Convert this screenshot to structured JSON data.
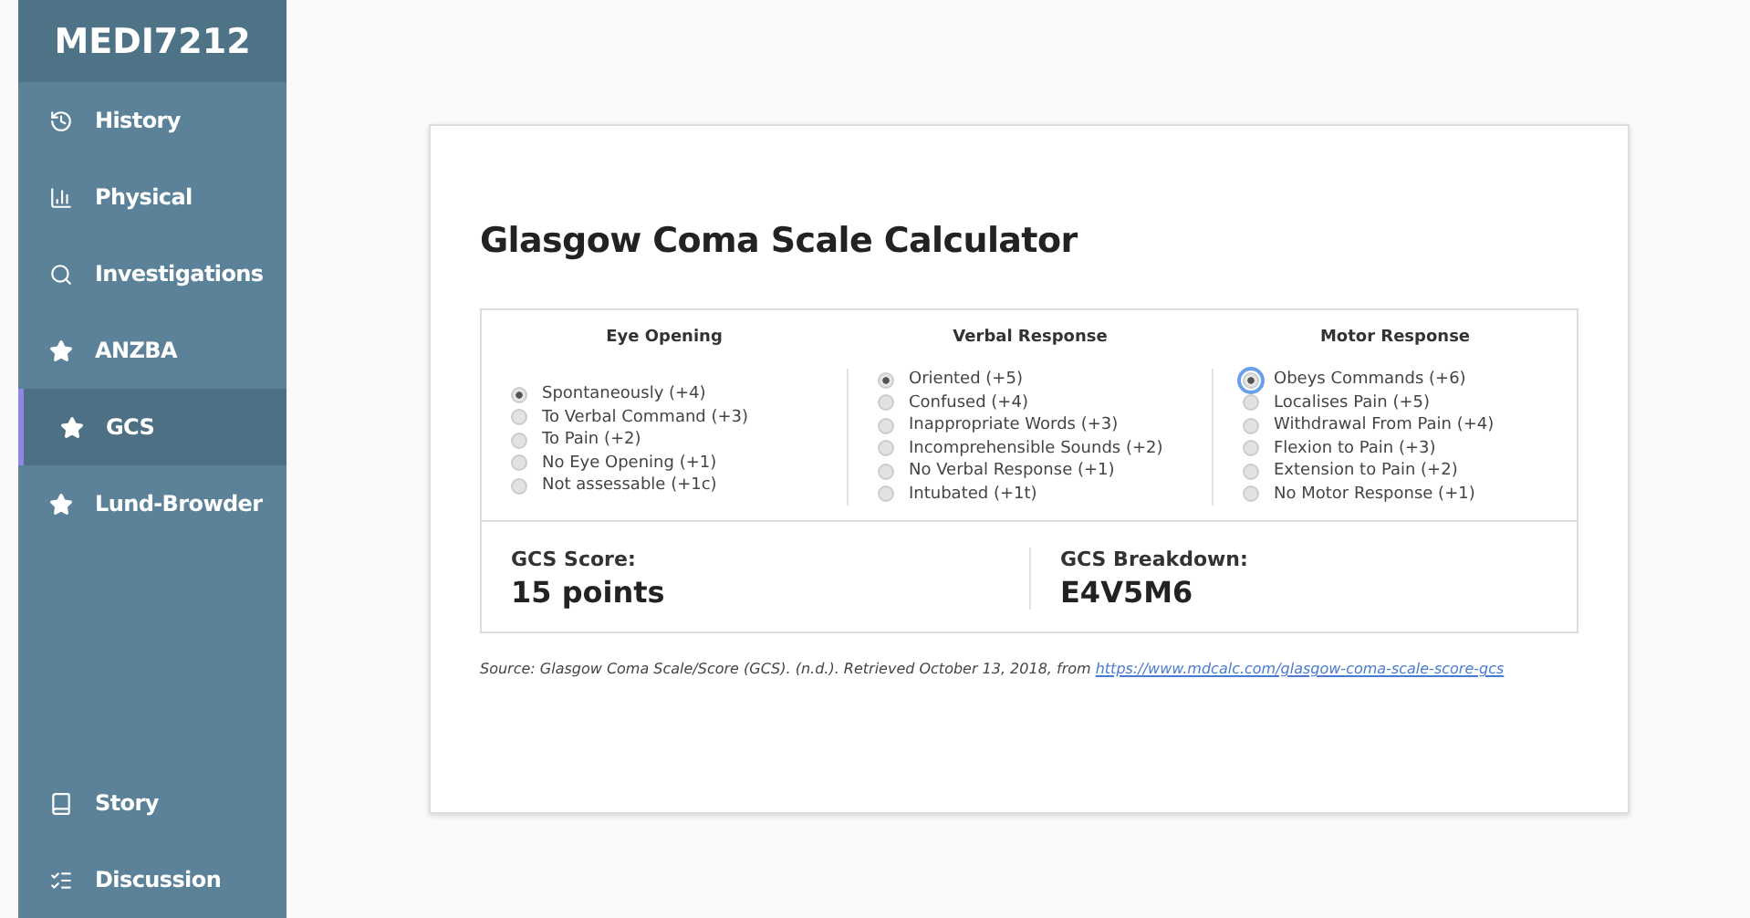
{
  "sidebar": {
    "title": "MEDI7212",
    "items": [
      {
        "label": "History",
        "kind": "history",
        "selected": false
      },
      {
        "label": "Physical",
        "kind": "chart",
        "selected": false
      },
      {
        "label": "Investigations",
        "kind": "search",
        "selected": false
      },
      {
        "label": "ANZBA",
        "kind": "star",
        "selected": false
      },
      {
        "label": "GCS",
        "kind": "star",
        "selected": true
      },
      {
        "label": "Lund-Browder",
        "kind": "star",
        "selected": false
      }
    ],
    "bottom_items": [
      {
        "label": "Story",
        "kind": "book",
        "selected": false
      },
      {
        "label": "Discussion",
        "kind": "list",
        "selected": false
      }
    ]
  },
  "calculator": {
    "title": "Glasgow Coma Scale Calculator",
    "groups": [
      {
        "heading": "Eye Opening",
        "options": [
          {
            "label": "Spontaneously (+4)",
            "selected": true
          },
          {
            "label": "To Verbal Command (+3)",
            "selected": false
          },
          {
            "label": "To Pain (+2)",
            "selected": false
          },
          {
            "label": "No Eye Opening (+1)",
            "selected": false
          },
          {
            "label": "Not assessable (+1c)",
            "selected": false
          }
        ]
      },
      {
        "heading": "Verbal Response",
        "options": [
          {
            "label": "Oriented (+5)",
            "selected": true
          },
          {
            "label": "Confused (+4)",
            "selected": false
          },
          {
            "label": "Inappropriate Words (+3)",
            "selected": false
          },
          {
            "label": "Incomprehensible Sounds (+2)",
            "selected": false
          },
          {
            "label": "No Verbal Response (+1)",
            "selected": false
          },
          {
            "label": "Intubated (+1t)",
            "selected": false
          }
        ]
      },
      {
        "heading": "Motor Response",
        "options": [
          {
            "label": "Obeys Commands (+6)",
            "selected": true
          },
          {
            "label": "Localises Pain (+5)",
            "selected": false
          },
          {
            "label": "Withdrawal From Pain (+4)",
            "selected": false
          },
          {
            "label": "Flexion to Pain (+3)",
            "selected": false
          },
          {
            "label": "Extension to Pain (+2)",
            "selected": false
          },
          {
            "label": "No Motor Response (+1)",
            "selected": false
          }
        ]
      }
    ],
    "results": [
      {
        "label": "GCS Score:",
        "value": "15 points"
      },
      {
        "label": "GCS Breakdown:",
        "value": "E4V5M6"
      }
    ],
    "source": {
      "text": "Source: Glasgow Coma Scale/Score (GCS). (n.d.). Retrieved October 13, 2018, from",
      "link": "https://www.mdcalc.com/glasgow-coma-scale-score-gcs"
    }
  }
}
